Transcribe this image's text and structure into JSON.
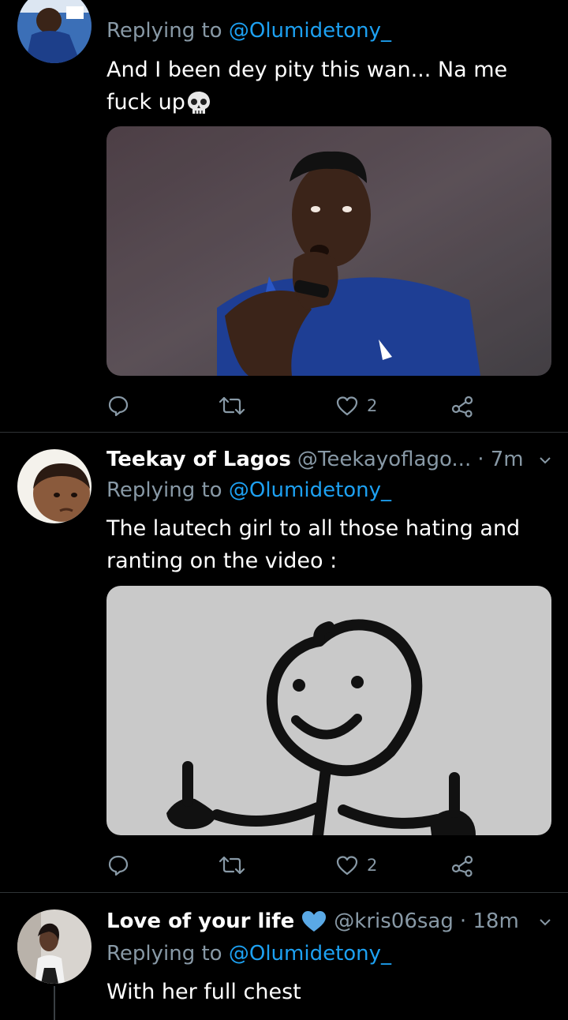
{
  "tweets": [
    {
      "reply_prefix": "Replying to",
      "reply_to": "@Olumidetony_",
      "text_line1": "And I been dey pity this wan... Na me",
      "text_line2": "fuck up",
      "emoji": "skull-emoji",
      "image": "player-biting-hand-photo",
      "actions": {
        "reply_count": "",
        "retweet_count": "",
        "like_count": "2"
      }
    },
    {
      "name": "Teekay of Lagos",
      "handle": "@Teekayoflago...",
      "time": "· 7m",
      "reply_prefix": "Replying to",
      "reply_to": "@Olumidetony_",
      "text_line1": "The lautech girl to all those hating and",
      "text_line2": "ranting on the video :",
      "image": "stick-figure-middle-fingers-drawing",
      "actions": {
        "reply_count": "",
        "retweet_count": "",
        "like_count": "2"
      }
    },
    {
      "name": "Love of your life",
      "badge": "blue-heart-emoji",
      "handle": "@kris06sag",
      "time": "· 18m",
      "reply_prefix": "Replying to",
      "reply_to": "@Olumidetony_",
      "text_line1": "With her full chest"
    }
  ],
  "colors": {
    "background": "#000000",
    "muted": "#8899a6",
    "link": "#1da1f2",
    "divider": "#2f3336"
  }
}
